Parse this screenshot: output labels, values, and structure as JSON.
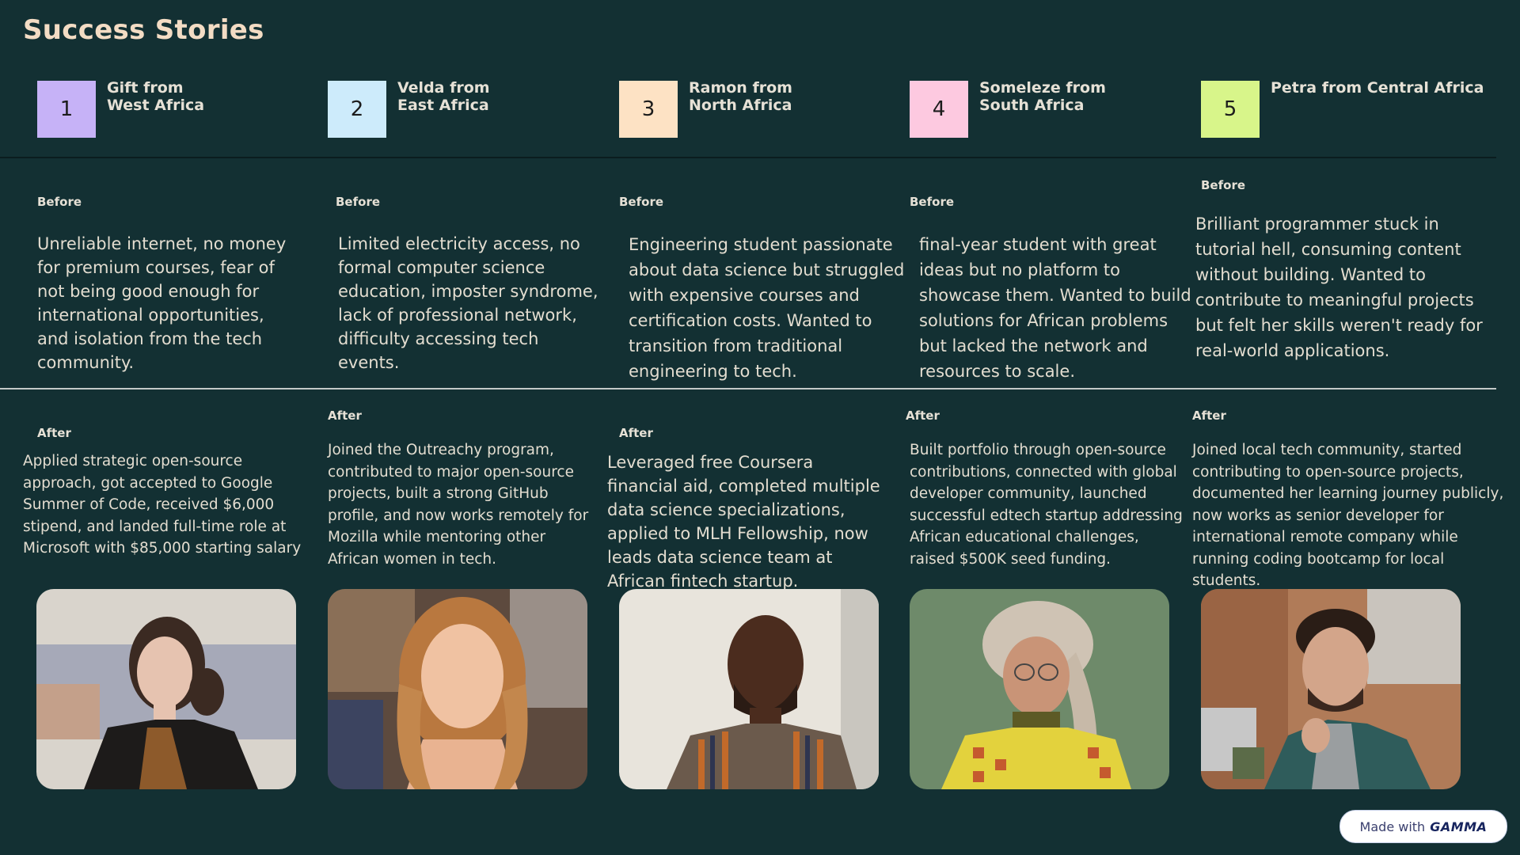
{
  "title": "Success Stories",
  "labels": {
    "before": "Before",
    "after": "After"
  },
  "stories": [
    {
      "number": "1",
      "name": "Gift from\nWest Africa",
      "color": "#c6b2f7",
      "before": "Unreliable internet, no money for premium courses, fear of not being good enough for international opportunities, and isolation from the tech community.",
      "after": "Applied strategic open-source approach, got accepted to Google Summer of Code, received $6,000 stipend, and landed full-time role at Microsoft with $85,000 starting salary"
    },
    {
      "number": "2",
      "name": "Velda from\nEast Africa",
      "color": "#cdebfb",
      "before": "Limited electricity access, no formal computer science education, imposter syndrome, lack of professional network, difficulty accessing tech events.",
      "after": "Joined the Outreachy program, contributed to major open-source projects, built a strong GitHub profile, and now works remotely for Mozilla while mentoring other African women in tech."
    },
    {
      "number": "3",
      "name": "Ramon from\nNorth Africa",
      "color": "#fde2c4",
      "before": "Engineering student passionate about data science but struggled with expensive courses and certification costs. Wanted to transition from traditional engineering to tech.",
      "after": "Leveraged free Coursera financial aid, completed multiple data science specializations, applied to MLH Fellowship, now leads data science team at African fintech startup."
    },
    {
      "number": "4",
      "name": "Someleze from\nSouth Africa",
      "color": "#fdc9e0",
      "before": "final-year student with great ideas but no platform to showcase them. Wanted to build solutions for African problems but lacked the network and resources to scale.",
      "after": "Built portfolio through open-source contributions, connected with global developer community, launched successful edtech startup addressing African educational challenges, raised $500K seed funding."
    },
    {
      "number": "5",
      "name": "Petra from Central Africa",
      "color": "#d8f58a",
      "before": "Brilliant programmer stuck in tutorial hell, consuming content without building. Wanted to contribute to meaningful projects but felt her skills weren't ready for real-world applications.",
      "after": "Joined local tech community, started contributing to open-source projects, documented her learning journey publicly, now works as senior developer for international remote company while running coding bootcamp for local students."
    }
  ],
  "badge": {
    "prefix": "Made with",
    "brand": "GAMMA"
  }
}
